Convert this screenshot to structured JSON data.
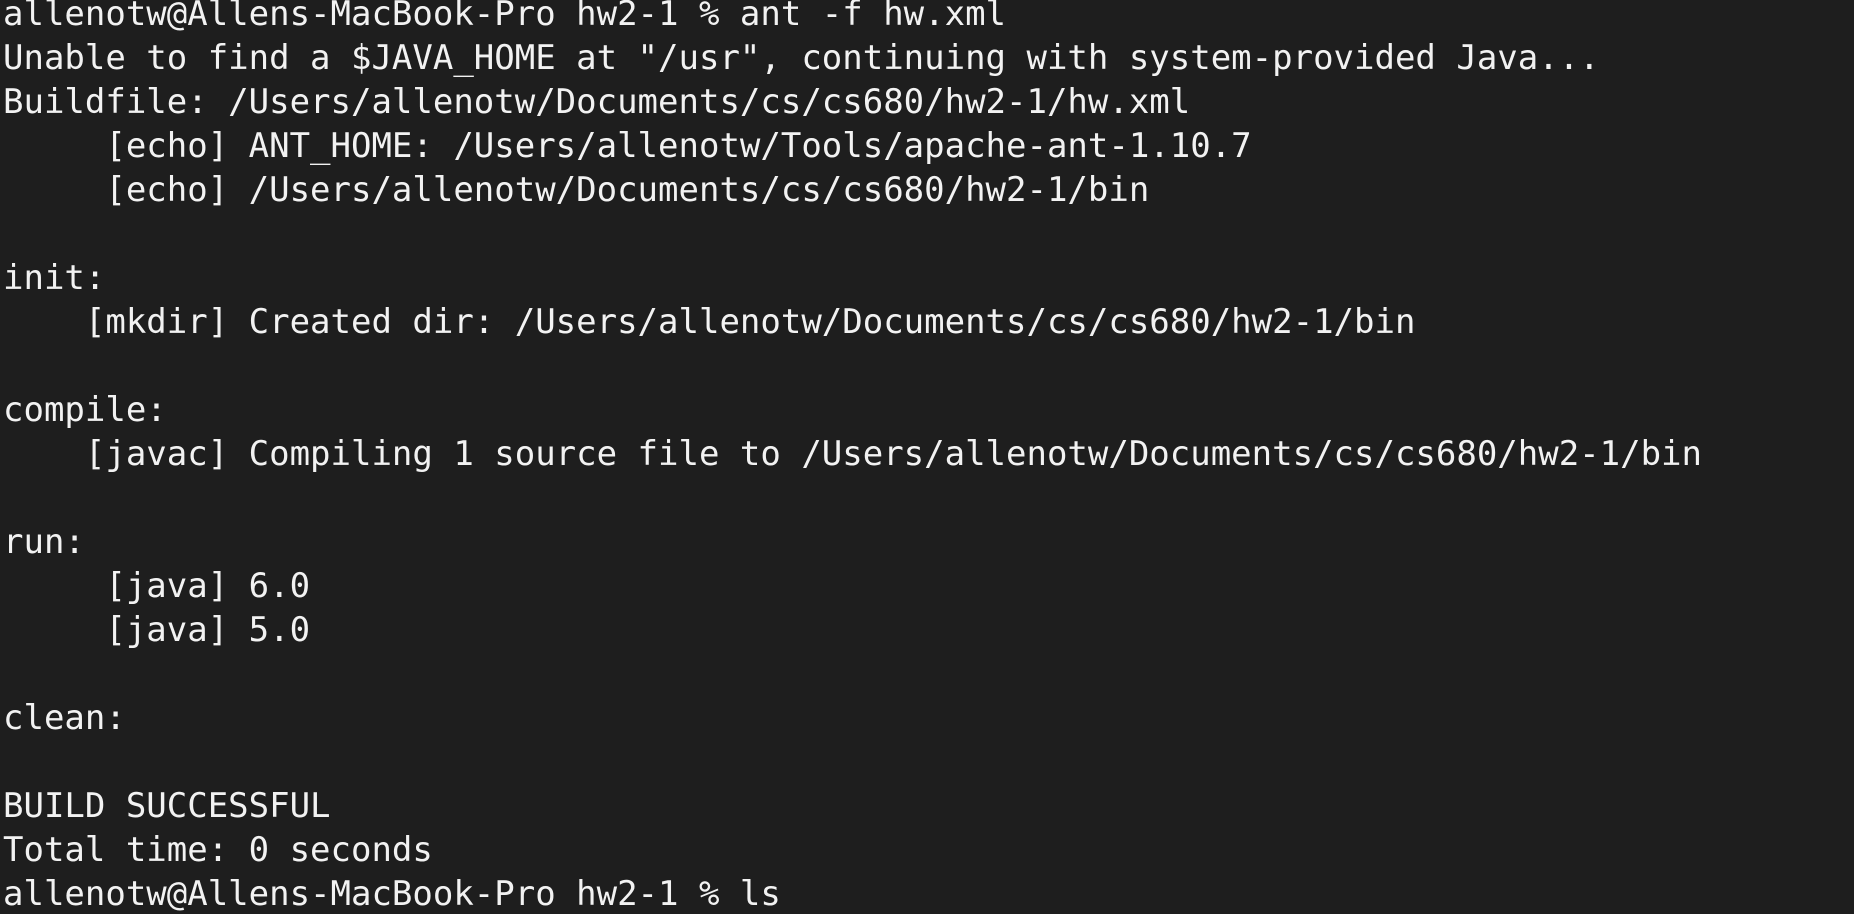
{
  "terminal": {
    "lines": [
      "allenotw@Allens-MacBook-Pro hw2-1 % ant -f hw.xml",
      "Unable to find a $JAVA_HOME at \"/usr\", continuing with system-provided Java...",
      "Buildfile: /Users/allenotw/Documents/cs/cs680/hw2-1/hw.xml",
      "     [echo] ANT_HOME: /Users/allenotw/Tools/apache-ant-1.10.7",
      "     [echo] /Users/allenotw/Documents/cs/cs680/hw2-1/bin",
      "",
      "init:",
      "    [mkdir] Created dir: /Users/allenotw/Documents/cs/cs680/hw2-1/bin",
      "",
      "compile:",
      "    [javac] Compiling 1 source file to /Users/allenotw/Documents/cs/cs680/hw2-1/bin",
      "",
      "run:",
      "     [java] 6.0",
      "     [java] 5.0",
      "",
      "clean:",
      "",
      "BUILD SUCCESSFUL",
      "Total time: 0 seconds",
      "allenotw@Allens-MacBook-Pro hw2-1 % ls"
    ]
  },
  "colors": {
    "background": "#1e1e1e",
    "text": "#f2f2f2"
  }
}
